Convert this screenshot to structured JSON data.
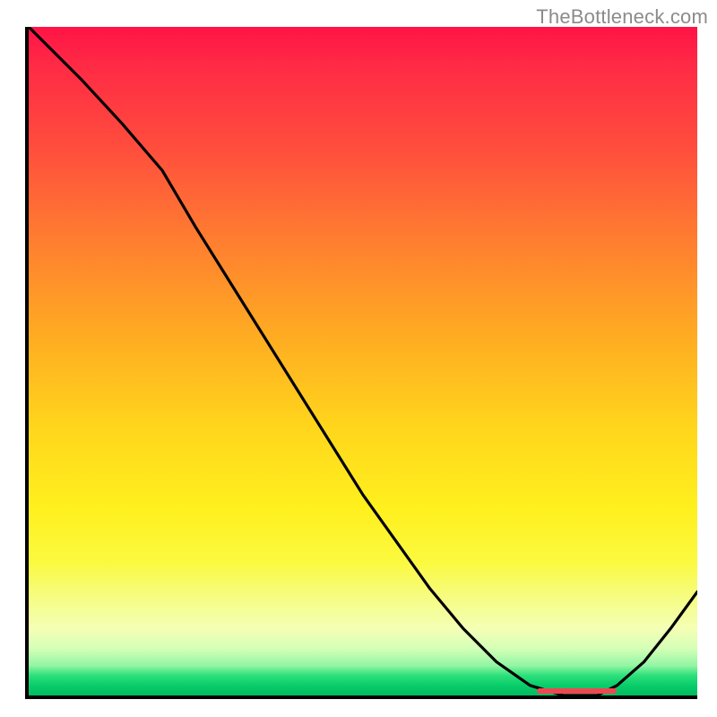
{
  "watermark": "TheBottleneck.com",
  "chart_data": {
    "type": "line",
    "title": "",
    "xlabel": "",
    "ylabel": "",
    "xlim": [
      0,
      100
    ],
    "ylim": [
      0,
      100
    ],
    "grid": false,
    "legend": false,
    "x": [
      0,
      8,
      14,
      20,
      25,
      30,
      35,
      40,
      45,
      50,
      55,
      60,
      65,
      70,
      75,
      80,
      85,
      88,
      92,
      96,
      100
    ],
    "values": [
      100,
      92,
      85.5,
      78.5,
      70,
      62,
      54,
      46,
      38,
      30,
      23,
      16,
      10,
      5,
      1.5,
      0,
      0,
      1.5,
      5,
      10,
      15.5
    ],
    "optimal_range_x": [
      76,
      88
    ],
    "gradient_colors": {
      "top": "#ff1446",
      "mid": "#fff01e",
      "bottom": "#00bb5e"
    },
    "curve_color": "#000000",
    "marker_color": "#ef4752"
  }
}
